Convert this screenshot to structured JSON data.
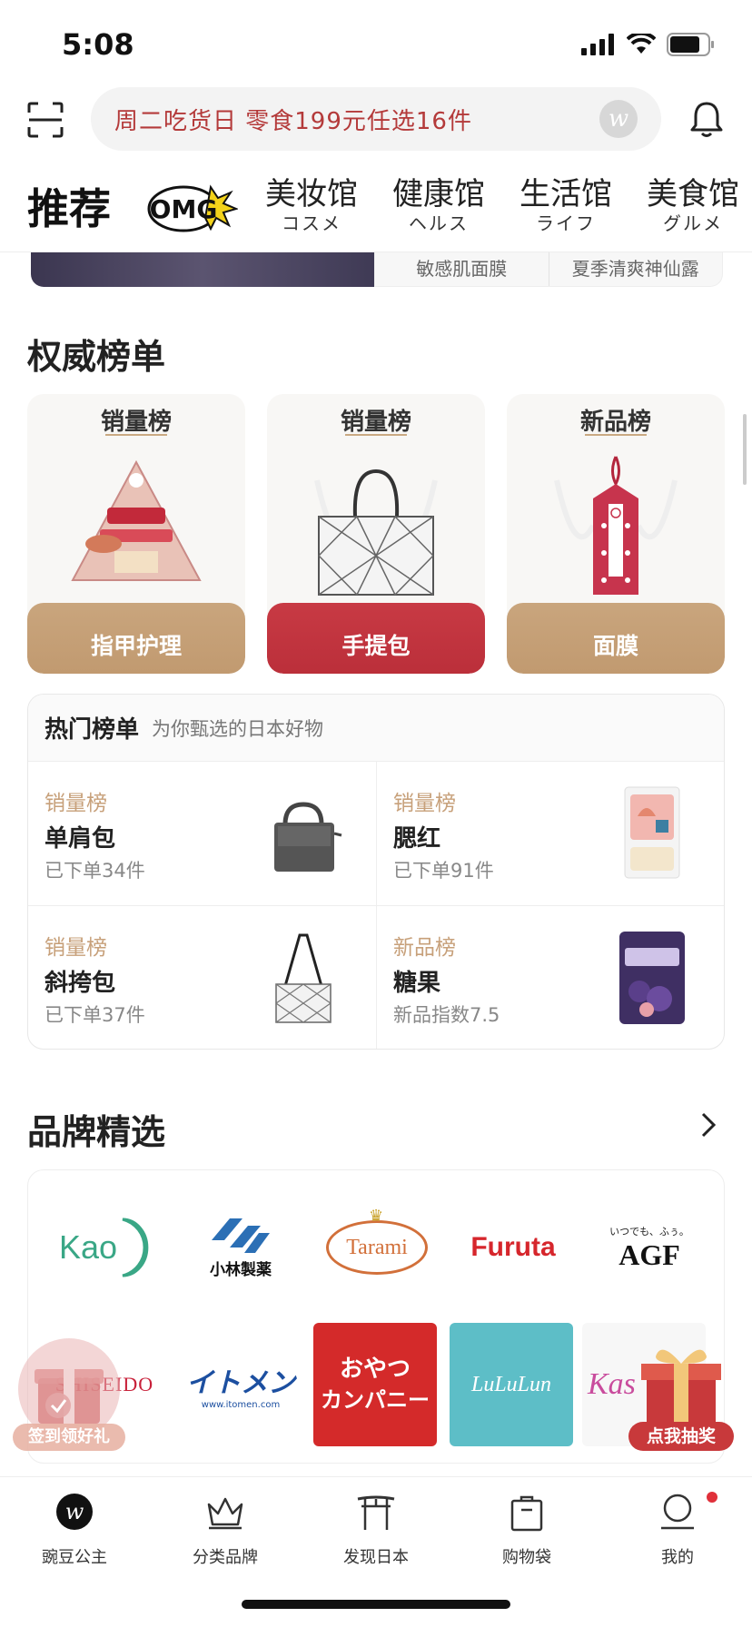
{
  "status_bar": {
    "time": "5:08"
  },
  "search": {
    "text": "周二吃货日  零食199元任选16件",
    "logo": "w"
  },
  "category_tabs": {
    "active": "推荐",
    "logo_text": "OMG",
    "items": [
      {
        "cn": "美妆馆",
        "jp": "コスメ"
      },
      {
        "cn": "健康馆",
        "jp": "ヘルス"
      },
      {
        "cn": "生活馆",
        "jp": "ライフ"
      },
      {
        "cn": "美食馆",
        "jp": "グルメ"
      }
    ]
  },
  "banner": {
    "tags": [
      "敏感肌面膜",
      "夏季清爽神仙露"
    ]
  },
  "authority": {
    "title": "权威榜单",
    "cards": [
      {
        "rank": "销量榜",
        "category": "指甲护理"
      },
      {
        "rank": "销量榜",
        "category": "手提包"
      },
      {
        "rank": "新品榜",
        "category": "面膜"
      }
    ]
  },
  "hot_list": {
    "title": "热门榜单",
    "subtitle": "为你甄选的日本好物",
    "items": [
      {
        "type": "销量榜",
        "name": "单肩包",
        "info": "已下单34件"
      },
      {
        "type": "销量榜",
        "name": "腮红",
        "info": "已下单91件"
      },
      {
        "type": "销量榜",
        "name": "斜挎包",
        "info": "已下单37件"
      },
      {
        "type": "新品榜",
        "name": "糖果",
        "info": "新品指数7.5"
      }
    ]
  },
  "brands": {
    "title": "品牌精选",
    "row1": [
      "Kao",
      "小林製薬",
      "Tarami",
      "Furuta",
      "AGF"
    ],
    "agf_top": "いつでも、ふぅ。",
    "row2": [
      "SHISEIDO",
      "イトメン",
      "おやつカンパニー",
      "LuLuLun",
      "Kas"
    ],
    "itomen_url": "www.itomen.com",
    "oyatsu_lines": [
      "おやつ",
      "カンパニー"
    ]
  },
  "floats": {
    "checkin": "签到领好礼",
    "lottery": "点我抽奖"
  },
  "tab_bar": {
    "items": [
      {
        "label": "豌豆公主",
        "icon": "wandou-logo-icon"
      },
      {
        "label": "分类品牌",
        "icon": "crown-icon"
      },
      {
        "label": "发现日本",
        "icon": "torii-icon"
      },
      {
        "label": "购物袋",
        "icon": "shopping-bag-icon"
      },
      {
        "label": "我的",
        "icon": "profile-icon"
      }
    ]
  },
  "colors": {
    "accent_red": "#bb2f3a",
    "gold": "#c9a57d",
    "search_red": "#b43a3a"
  }
}
